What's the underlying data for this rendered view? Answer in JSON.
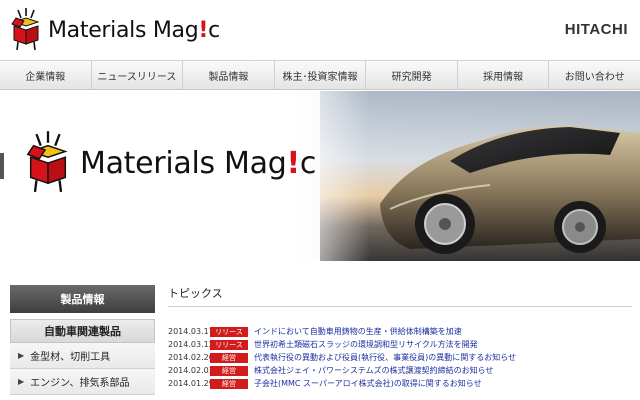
{
  "header": {
    "brand_left": "Materials Mag",
    "brand_bang": "!",
    "brand_right": "c",
    "corporate_logo": "HITACHI"
  },
  "nav": [
    {
      "label": "企業情報"
    },
    {
      "label": "ニュースリリース"
    },
    {
      "label": "製品情報"
    },
    {
      "label": "株主･投資家情報"
    },
    {
      "label": "研究開発"
    },
    {
      "label": "採用情報"
    },
    {
      "label": "お問い合わせ"
    }
  ],
  "hero": {
    "brand_left": "Materials Mag",
    "brand_bang": "!",
    "brand_right": "c"
  },
  "sidebar": {
    "heading": "製品情報",
    "subheading": "自動車関連製品",
    "items": [
      {
        "label": "金型材、切削工具"
      },
      {
        "label": "エンジン、排気系部品"
      }
    ]
  },
  "topics": {
    "title": "トピックス",
    "rows": [
      {
        "date": "2014.03.17",
        "badge": "リリース",
        "text": "インドにおいて自動車用鋳物の生産・供給体制構築を加速"
      },
      {
        "date": "2014.03.12",
        "badge": "リリース",
        "text": "世界初希土類磁石スラッジの環境調和型リサイクル方法を開発"
      },
      {
        "date": "2014.02.26",
        "badge": "経営",
        "text": "代表執行役の異動および役員(執行役、事業役員)の異動に関するお知らせ"
      },
      {
        "date": "2014.02.03",
        "badge": "経営",
        "text": "株式会社ジェイ・パワーシステムズの株式譲渡契約締結のお知らせ"
      },
      {
        "date": "2014.01.29",
        "badge": "経営",
        "text": "子会社(MMC スーパーアロイ株式会社)の取得に関するお知らせ"
      }
    ]
  },
  "colors": {
    "accent_red": "#d21b1b",
    "link_blue": "#1a2fa0",
    "sidebar_dark": "#4a4a4a"
  },
  "icons": {
    "logo_mark": "open-box-mascot-icon",
    "arrow": "triangle-right-icon"
  }
}
